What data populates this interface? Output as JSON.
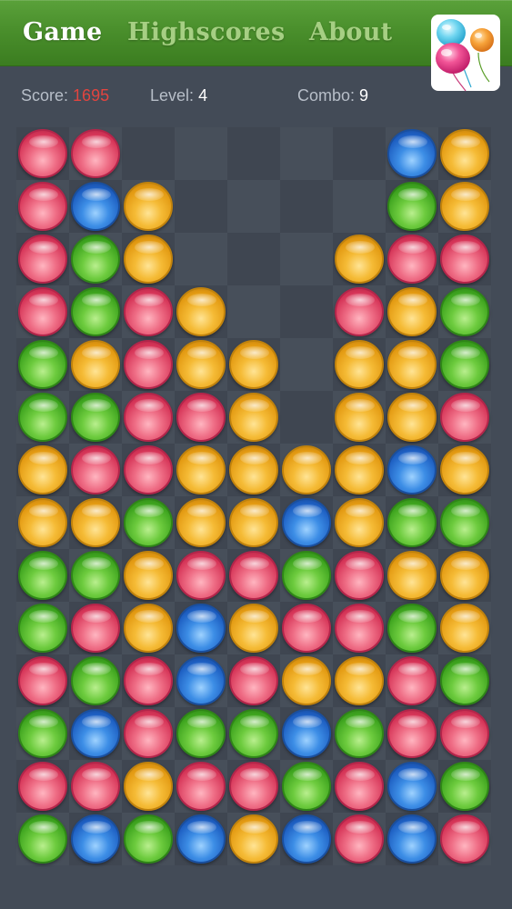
{
  "nav": {
    "tabs": [
      {
        "label": "Game",
        "active": true
      },
      {
        "label": "Highscores",
        "active": false
      },
      {
        "label": "About",
        "active": false
      }
    ],
    "logo_icon": "balloons-icon"
  },
  "status": {
    "score_label": "Score:",
    "score_value": "1695",
    "level_label": "Level:",
    "level_value": "4",
    "combo_label": "Combo:",
    "combo_value": "9"
  },
  "colors": {
    "background": "#434b57",
    "nav_green": "#4a8f2c",
    "score_red": "#e2443f",
    "ball_red": "#d63558",
    "ball_green": "#3ea41f",
    "ball_blue": "#1e5fc2",
    "ball_yellow": "#e39a12"
  },
  "board": {
    "columns": 9,
    "rows": 14,
    "legend": {
      "R": "red",
      "G": "green",
      "B": "blue",
      "Y": "yellow",
      ".": "empty"
    },
    "grid": [
      "RR.....BY",
      "RBY....GY",
      "RGY...YRR",
      "RGRY..RYG",
      "GYRYY.YYG",
      "GGRRY.YYR",
      "YRRYYYYBY",
      "YYGYYBYGG",
      "GGYRRGRYY",
      "GRYBYRRGY",
      "RGRBRYYRG",
      "GBRGGBGRR",
      "RRYRRGRBG",
      "GBGBYBRBR"
    ]
  }
}
